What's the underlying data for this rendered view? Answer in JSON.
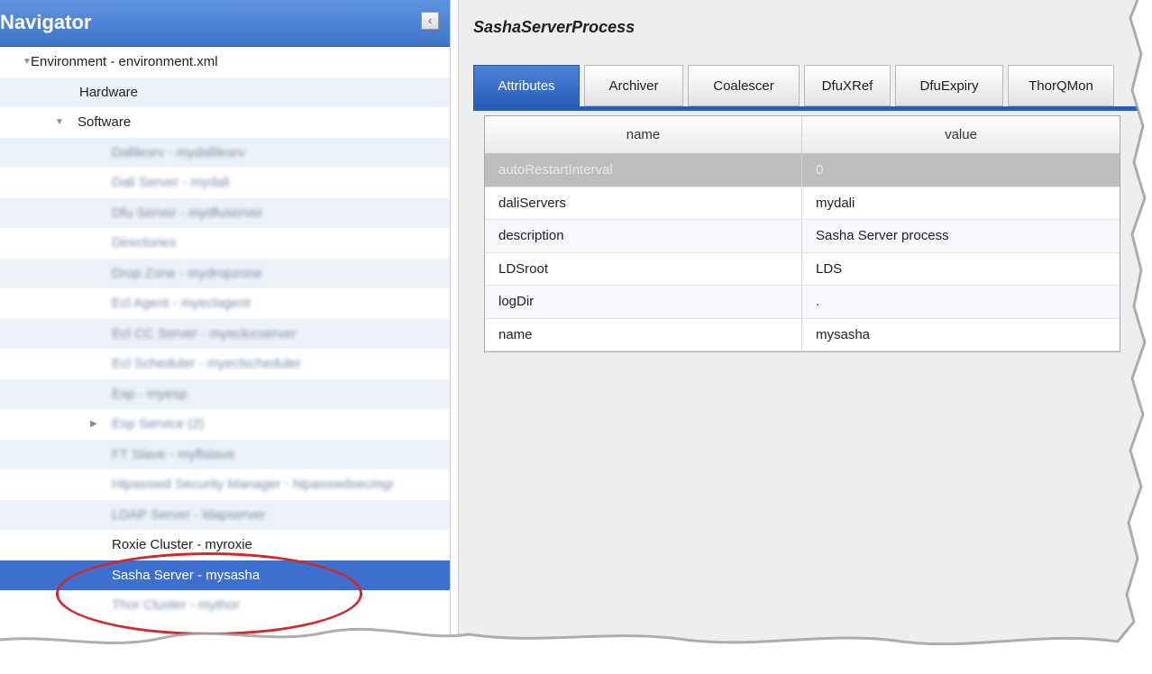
{
  "navigator": {
    "title": "Navigator",
    "collapse_glyph": "‹",
    "tree": [
      {
        "label": "Environment - environment.xml",
        "toggle": "▼",
        "blurred": false
      },
      {
        "label": "Hardware",
        "toggle": "",
        "blurred": false
      },
      {
        "label": "Software",
        "toggle": "▼",
        "blurred": false
      },
      {
        "label": "Dafilesrv - mydafilesrv",
        "toggle": "",
        "blurred": true
      },
      {
        "label": "Dali Server - mydali",
        "toggle": "",
        "blurred": true
      },
      {
        "label": "Dfu Server - mydfuserver",
        "toggle": "",
        "blurred": true
      },
      {
        "label": "Directories",
        "toggle": "",
        "blurred": true
      },
      {
        "label": "Drop Zone - mydropzone",
        "toggle": "",
        "blurred": true
      },
      {
        "label": "Ecl Agent - myeclagent",
        "toggle": "",
        "blurred": true
      },
      {
        "label": "Ecl CC Server - myeclccserver",
        "toggle": "",
        "blurred": true
      },
      {
        "label": "Ecl Scheduler - myeclscheduler",
        "toggle": "",
        "blurred": true
      },
      {
        "label": "Esp - myesp",
        "toggle": "",
        "blurred": true
      },
      {
        "label": "Esp Service (2)",
        "toggle": "▶",
        "blurred": true
      },
      {
        "label": "FT Slave - myftslave",
        "toggle": "",
        "blurred": true
      },
      {
        "label": "Htpasswd Security Manager - htpasswdsecmgr",
        "toggle": "",
        "blurred": true
      },
      {
        "label": "LDAP Server - ldapserver",
        "toggle": "",
        "blurred": true
      },
      {
        "label": "Roxie Cluster - myroxie",
        "toggle": "",
        "blurred": false
      },
      {
        "label": "Sasha Server - mysasha",
        "toggle": "",
        "blurred": false,
        "selected": true
      },
      {
        "label": "Thor Cluster - mythor",
        "toggle": "",
        "blurred": true
      }
    ]
  },
  "panel": {
    "title": "SashaServerProcess",
    "tabs": [
      "Attributes",
      "Archiver",
      "Coalescer",
      "DfuXRef",
      "DfuExpiry",
      "ThorQMon"
    ],
    "active_tab": "Attributes",
    "columns": [
      "name",
      "value"
    ],
    "rows": [
      {
        "name": "autoRestartInterval",
        "value": "0",
        "selected": true
      },
      {
        "name": "daliServers",
        "value": "mydali"
      },
      {
        "name": "description",
        "value": "Sasha Server process"
      },
      {
        "name": "LDSroot",
        "value": "LDS"
      },
      {
        "name": "logDir",
        "value": "."
      },
      {
        "name": "name",
        "value": "mysasha"
      }
    ]
  },
  "colors": {
    "header_blue": "#3f74c8",
    "selection_blue": "#3c6fce",
    "highlight_ellipse": "#d22a2a"
  }
}
